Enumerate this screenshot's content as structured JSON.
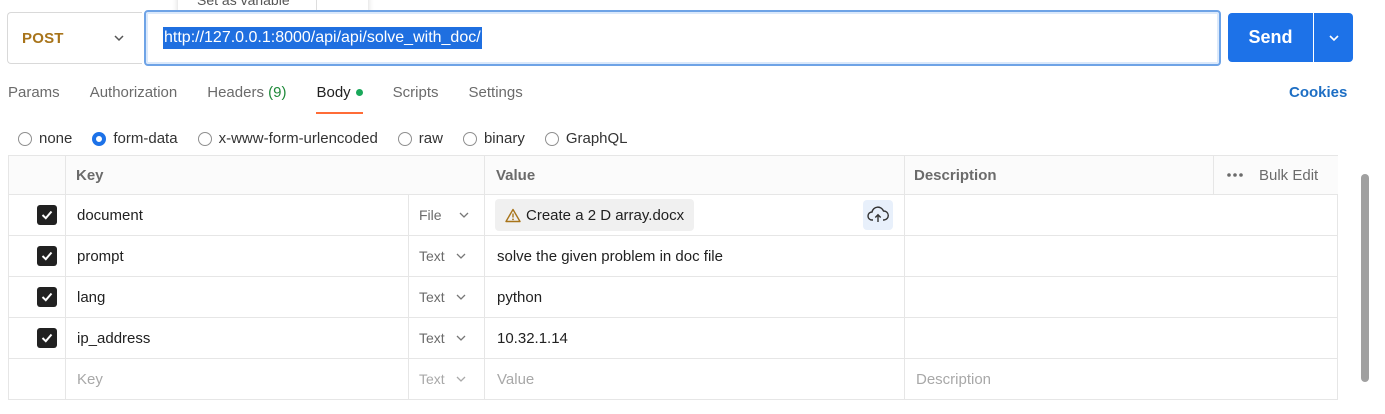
{
  "request": {
    "method": "POST",
    "url": "http://127.0.0.1:8000/api/api/solve_with_doc/",
    "send_label": "Send"
  },
  "tooltip": {
    "label": "Set as variable"
  },
  "tabs": [
    {
      "label": "Params"
    },
    {
      "label": "Authorization"
    },
    {
      "label": "Headers",
      "count": "(9)"
    },
    {
      "label": "Body",
      "active": true
    },
    {
      "label": "Scripts"
    },
    {
      "label": "Settings"
    }
  ],
  "cookies_label": "Cookies",
  "body_types": [
    {
      "label": "none",
      "checked": false
    },
    {
      "label": "form-data",
      "checked": true
    },
    {
      "label": "x-www-form-urlencoded",
      "checked": false
    },
    {
      "label": "raw",
      "checked": false
    },
    {
      "label": "binary",
      "checked": false
    },
    {
      "label": "GraphQL",
      "checked": false
    }
  ],
  "table": {
    "headers": {
      "key": "Key",
      "value": "Value",
      "description": "Description",
      "bulk_edit": "Bulk Edit"
    },
    "rows": [
      {
        "key": "document",
        "type": "File",
        "value": "Create a 2 D array.docx",
        "checked": true
      },
      {
        "key": "prompt",
        "type": "Text",
        "value": "solve the given problem in doc file",
        "checked": true
      },
      {
        "key": "lang",
        "type": "Text",
        "value": "python",
        "checked": true
      },
      {
        "key": "ip_address",
        "type": "Text",
        "value": "10.32.1.14",
        "checked": true
      }
    ],
    "placeholder": {
      "key": "Key",
      "type": "Text",
      "value": "Value",
      "description": "Description"
    }
  },
  "colors": {
    "accent": "#1d72e8",
    "method": "#a8741a",
    "active_tab": "#ff6c37",
    "cookies": "#1d6ec4"
  }
}
